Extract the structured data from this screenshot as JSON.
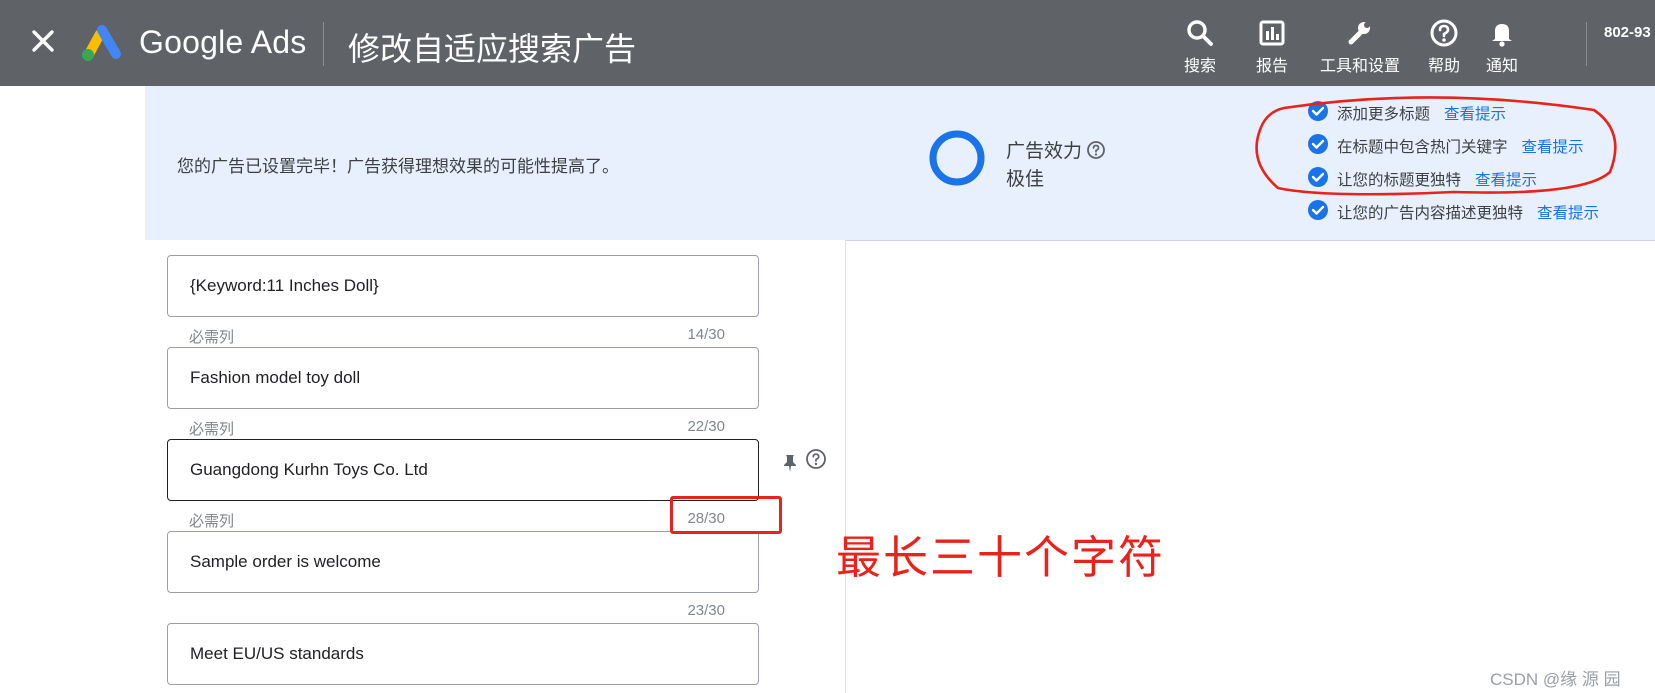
{
  "header": {
    "app_name": "Google Ads",
    "page_title": "修改自适应搜索广告",
    "tools": [
      {
        "label": "搜索",
        "icon": "search-icon"
      },
      {
        "label": "报告",
        "icon": "reports-icon"
      },
      {
        "label": "工具和设置",
        "icon": "wrench-icon"
      },
      {
        "label": "帮助",
        "icon": "help-icon"
      },
      {
        "label": "通知",
        "icon": "bell-icon"
      }
    ],
    "account_id": "802-93"
  },
  "banner": {
    "message": "您的广告已设置完毕！广告获得理想效果的可能性提高了。",
    "strength_label": "广告效力",
    "strength_value": "极佳",
    "strength_level": 1.0,
    "tips": [
      {
        "text": "添加更多标题",
        "link": "查看提示"
      },
      {
        "text": "在标题中包含热门关键字",
        "link": "查看提示"
      },
      {
        "text": "让您的标题更独特",
        "link": "查看提示"
      },
      {
        "text": "让您的广告内容描述更独特",
        "link": "查看提示"
      }
    ]
  },
  "headlines": [
    {
      "value": "{Keyword:11 Inches Doll}",
      "required_label": "必需列",
      "count": "14/30"
    },
    {
      "value": "Fashion model toy doll",
      "required_label": "必需列",
      "count": "22/30"
    },
    {
      "value": "Guangdong Kurhn Toys Co. Ltd",
      "required_label": "必需列",
      "count": "28/30"
    },
    {
      "value": "Sample order is welcome",
      "required_label": "",
      "count": "23/30"
    },
    {
      "value": "Meet EU/US standards"
    }
  ],
  "annotation": {
    "text": "最长三十个字符"
  },
  "watermark": "CSDN @缘  源  园",
  "colors": {
    "topbar": "#5f6368",
    "banner": "#e8f0fe",
    "accent": "#1a73e8",
    "annotation": "#e8231b"
  }
}
